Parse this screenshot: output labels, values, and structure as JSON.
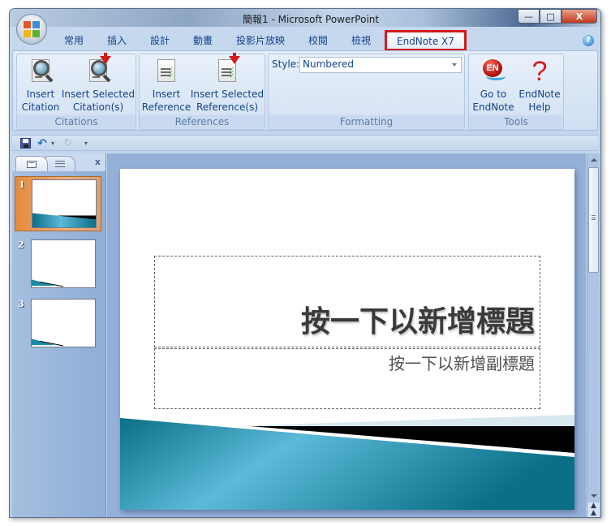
{
  "window": {
    "title": "簡報1 - Microsoft PowerPoint",
    "controls": {
      "minimize": "—",
      "maximize": "□",
      "close": "X"
    }
  },
  "office_button": {
    "icon": "office-logo-icon"
  },
  "ribbon_tabs": [
    {
      "label": "常用",
      "active": false
    },
    {
      "label": "插入",
      "active": false
    },
    {
      "label": "設計",
      "active": false
    },
    {
      "label": "動畫",
      "active": false
    },
    {
      "label": "投影片放映",
      "active": false
    },
    {
      "label": "校閱",
      "active": false
    },
    {
      "label": "檢視",
      "active": false
    },
    {
      "label": "EndNote X7",
      "active": true,
      "highlight_color": "#d21a1a"
    }
  ],
  "help_icon": "?",
  "ribbon": {
    "groups": [
      {
        "label": "Citations",
        "buttons": [
          {
            "label_line1": "Insert",
            "label_line2": "Citation",
            "icon": "magnifier-document-icon"
          },
          {
            "label_line1": "Insert Selected",
            "label_line2": "Citation(s)",
            "icon": "magnifier-document-arrow-icon"
          }
        ]
      },
      {
        "label": "References",
        "buttons": [
          {
            "label_line1": "Insert",
            "label_line2": "Reference",
            "icon": "reference-document-icon"
          },
          {
            "label_line1": "Insert Selected",
            "label_line2": "Reference(s)",
            "icon": "reference-document-arrow-icon"
          }
        ]
      },
      {
        "label": "Formatting",
        "style_label": "Style:",
        "style_value": "Numbered"
      },
      {
        "label": "Tools",
        "buttons": [
          {
            "label_line1": "Go to",
            "label_line2": "EndNote",
            "icon": "endnote-logo-icon",
            "icon_text": "EN"
          },
          {
            "label_line1": "EndNote",
            "label_line2": "Help",
            "icon": "question-mark-icon",
            "icon_text": "?"
          }
        ]
      }
    ]
  },
  "quick_access": {
    "items": [
      {
        "name": "save",
        "icon": "save-icon"
      },
      {
        "name": "undo",
        "icon": "undo-icon",
        "glyph": "↶"
      },
      {
        "name": "undo-dropdown",
        "icon": "chevron-down-icon",
        "glyph": "▾"
      },
      {
        "name": "redo",
        "icon": "redo-icon",
        "glyph": "↻"
      },
      {
        "name": "customize",
        "icon": "customize-icon",
        "glyph": "▾"
      }
    ]
  },
  "slides_pane": {
    "close_glyph": "x",
    "slides": [
      {
        "number": "1",
        "selected": true
      },
      {
        "number": "2",
        "selected": false
      },
      {
        "number": "3",
        "selected": false
      }
    ]
  },
  "slide": {
    "title_placeholder": "按一下以新增標題",
    "subtitle_placeholder": "按一下以新增副標題",
    "colors": {
      "teal_dark": "#0a6f87",
      "teal_light": "#5bbad8",
      "black_band": "#000000"
    }
  },
  "scrollbar": {
    "prev_slide_glyph": "▲\n▲"
  }
}
